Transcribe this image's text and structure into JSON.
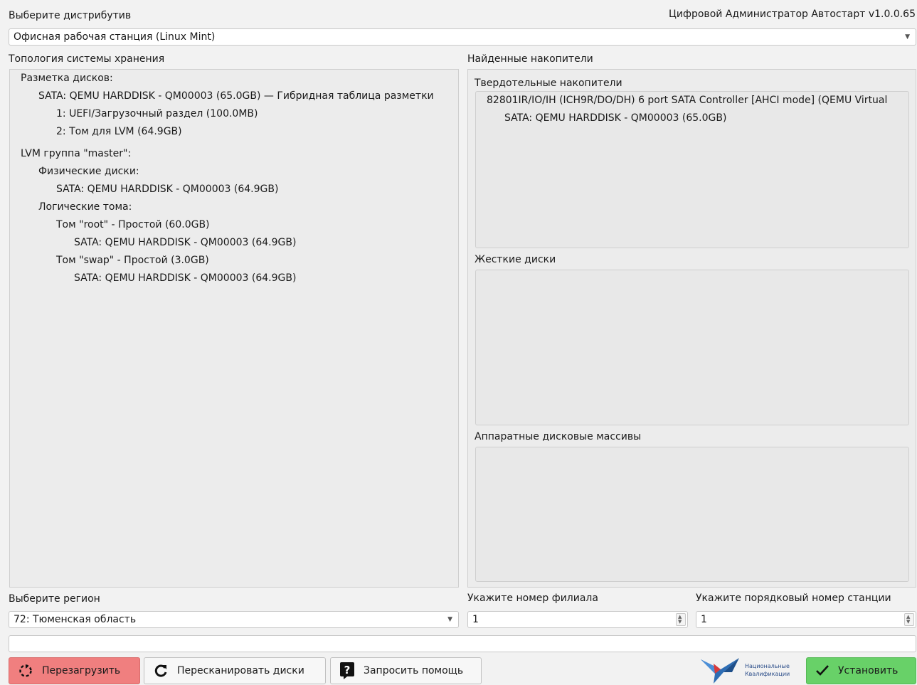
{
  "header": {
    "distro_label": "Выберите дистрибутив",
    "app_title": "Цифровой Администратор Автостарт  v1.0.0.65"
  },
  "distro_select": {
    "value": "Офисная рабочая станция (Linux Mint)"
  },
  "topology": {
    "title": "Топология системы хранения",
    "lines": [
      "Разметка дисков:",
      "SATA: QEMU HARDDISK - QM00003 (65.0GB) — Гибридная таблица разметки",
      "1: UEFI/Загрузочный раздел (100.0MB)",
      "2: Том для LVM (64.9GB)",
      "LVM группа \"master\":",
      "Физические диски:",
      "SATA: QEMU HARDDISK - QM00003 (64.9GB)",
      "Логические тома:",
      "Том \"root\" - Простой (60.0GB)",
      "SATA: QEMU HARDDISK - QM00003 (64.9GB)",
      "Том \"swap\" - Простой (3.0GB)",
      "SATA: QEMU HARDDISK - QM00003 (64.9GB)"
    ]
  },
  "drives": {
    "title": "Найденные накопители",
    "ssd_title": "Твердотельные накопители",
    "ssd_items": [
      "82801IR/IO/IH (ICH9R/DO/DH) 6 port SATA Controller [AHCI mode] (QEMU Virtual",
      "SATA: QEMU HARDDISK - QM00003 (65.0GB)"
    ],
    "hdd_title": "Жесткие диски",
    "raid_title": "Аппаратные дисковые массивы"
  },
  "region": {
    "label": "Выберите регион",
    "value": "72: Тюменская область"
  },
  "branch": {
    "label": "Укажите номер филиала",
    "value": "1"
  },
  "station": {
    "label": "Укажите порядковый номер станции",
    "value": "1"
  },
  "status_text": "",
  "buttons": {
    "reboot": "Перезагрузить",
    "rescan": "Пересканировать диски",
    "help": "Запросить помощь",
    "install": "Установить"
  },
  "logo": {
    "line1": "Национальные",
    "line2": "Квалификации"
  },
  "colors": {
    "reboot_bg": "#f07f7f",
    "install_bg": "#68d168"
  }
}
